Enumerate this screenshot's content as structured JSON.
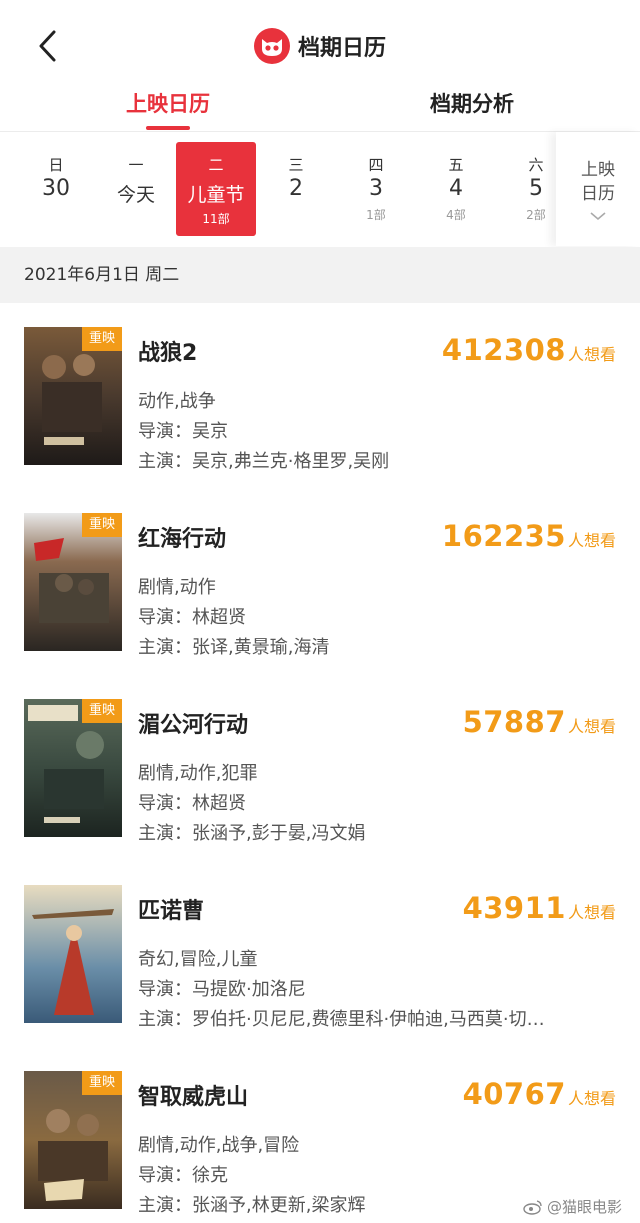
{
  "header": {
    "title": "档期日历",
    "back_icon": "chevron-left-icon",
    "logo_icon": "cat-logo-icon"
  },
  "tabs": [
    {
      "label": "上映日历",
      "active": true
    },
    {
      "label": "档期分析",
      "active": false
    }
  ],
  "days": [
    {
      "weekday": "日",
      "date": "30",
      "count": ""
    },
    {
      "weekday": "一",
      "date": "今天",
      "count": ""
    },
    {
      "weekday": "二",
      "date": "儿童节",
      "count": "11部",
      "active": true
    },
    {
      "weekday": "三",
      "date": "2",
      "count": ""
    },
    {
      "weekday": "四",
      "date": "3",
      "count": "1部"
    },
    {
      "weekday": "五",
      "date": "4",
      "count": "4部"
    },
    {
      "weekday": "六",
      "date": "5",
      "count": "2部"
    }
  ],
  "calendar_button": {
    "line1": "上映",
    "line2": "日历"
  },
  "section_date": "2021年6月1日 周二",
  "want_suffix": "人想看",
  "movies": [
    {
      "name": "战狼2",
      "badge": "重映",
      "genre": "动作,战争",
      "director": "导演：吴京",
      "cast": "主演：吴京,弗兰克·格里罗,吴刚",
      "want": "412308"
    },
    {
      "name": "红海行动",
      "badge": "重映",
      "genre": "剧情,动作",
      "director": "导演：林超贤",
      "cast": "主演：张译,黄景瑜,海清",
      "want": "162235"
    },
    {
      "name": "湄公河行动",
      "badge": "重映",
      "genre": "剧情,动作,犯罪",
      "director": "导演：林超贤",
      "cast": "主演：张涵予,彭于晏,冯文娟",
      "want": "57887"
    },
    {
      "name": "匹诺曹",
      "badge": "",
      "genre": "奇幻,冒险,儿童",
      "director": "导演：马提欧·加洛尼",
      "cast": "主演：罗伯托·贝尼尼,费德里科·伊帕迪,马西莫·切…",
      "want": "43911"
    },
    {
      "name": "智取威虎山",
      "badge": "重映",
      "genre": "剧情,动作,战争,冒险",
      "director": "导演：徐克",
      "cast": "主演：张涵予,林更新,梁家辉",
      "want": "40767"
    }
  ],
  "watermark": "@猫眼电影",
  "colors": {
    "brand_red": "#e8323c",
    "want_orange": "#f29b18",
    "section_bg": "#f2f2f2"
  }
}
